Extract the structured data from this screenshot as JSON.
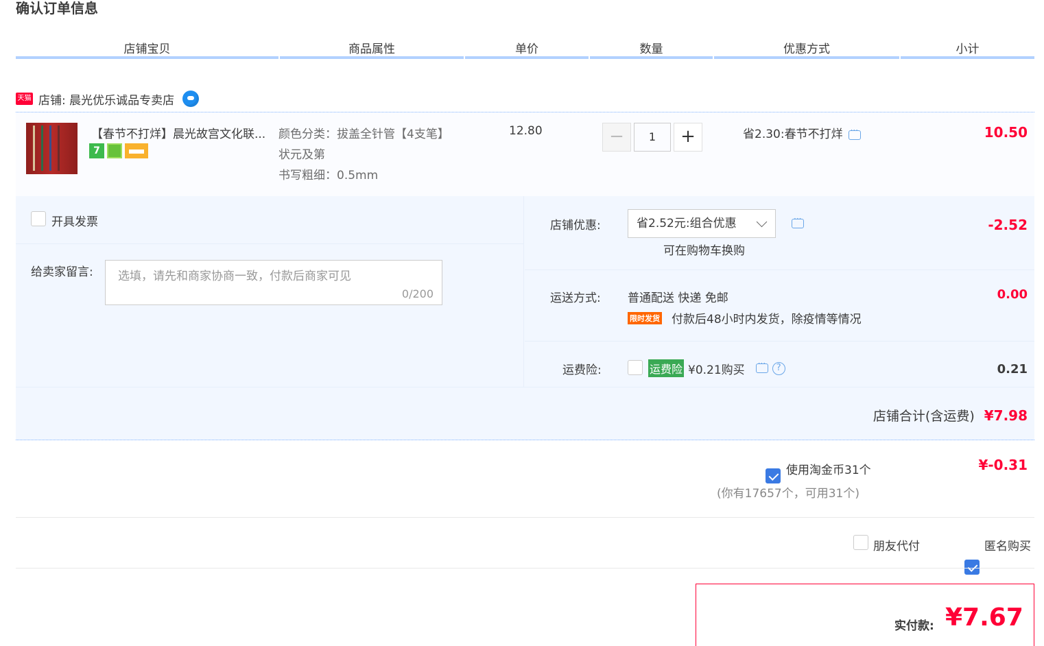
{
  "page_title": "确认订单信息",
  "columns": [
    "店铺宝贝",
    "商品属性",
    "单价",
    "数量",
    "优惠方式",
    "小计"
  ],
  "shop": {
    "tmall_badge": "天猫",
    "label": "店铺: 晨光优乐诚品专卖店"
  },
  "item": {
    "title": "【春节不打烊】晨光故宫文化联...",
    "badges": [
      "7",
      "",
      ""
    ],
    "props": {
      "line1": "颜色分类：拔盖全针管【4支笔】",
      "line2": "状元及第",
      "line3": "书写粗细：0.5mm"
    },
    "unit_price": "12.80",
    "quantity": "1",
    "qty_minus": "−",
    "qty_plus": "+",
    "promo": "省2.30:春节不打烊",
    "subtotal": "10.50"
  },
  "invoice": {
    "label": "开具发票",
    "checked": false
  },
  "message": {
    "label": "给卖家留言:",
    "placeholder": "选填，请先和商家协商一致，付款后商家可见",
    "counter": "0/200"
  },
  "shop_discount": {
    "label": "店铺优惠:",
    "selected": "省2.52元:组合优惠",
    "note": "可在购物车换购",
    "amount": "-2.52"
  },
  "shipping": {
    "label": "运送方式:",
    "method": "普通配送 快递 免邮",
    "tag": "限时发货",
    "note": "付款后48小时内发货，除疫情等情况",
    "amount": "0.00"
  },
  "insurance": {
    "label": "运费险:",
    "tag": "运费险",
    "price": "¥0.21购买",
    "amount": "0.21",
    "checked": false
  },
  "shop_total": {
    "label": "店铺合计(含运费)",
    "amount": "¥7.98"
  },
  "taojinbi": {
    "label": "使用淘金币31个",
    "sub": "(你有17657个，可用31个)",
    "amount": "¥-0.31",
    "checked": true
  },
  "friend_pay": {
    "label": "朋友代付",
    "checked": false
  },
  "anonymous": {
    "label": "匿名购买",
    "checked": true
  },
  "pay": {
    "label": "实付款:",
    "amount": "¥7.67"
  },
  "colors": {
    "accent_red": "#ff0036",
    "accent_blue": "#3a7ae3",
    "header_rule": "#b2d1ff",
    "option_bg": "#f2f7ff"
  }
}
